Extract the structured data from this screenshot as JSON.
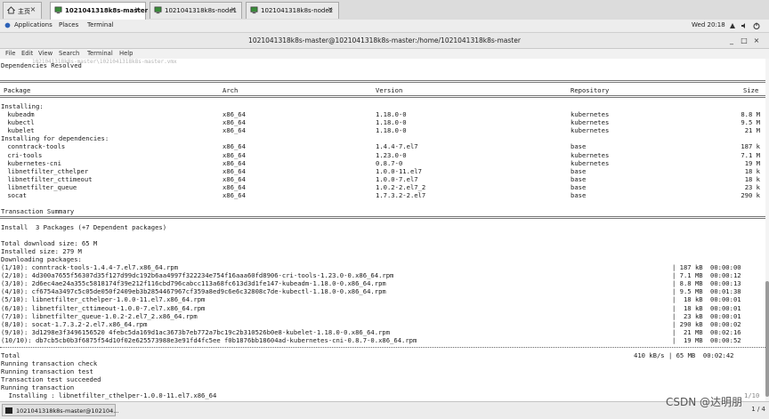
{
  "tabs": [
    {
      "label": "主页",
      "icon": "home-icon"
    },
    {
      "label": "1021041318k8s-master",
      "icon": "vm-icon"
    },
    {
      "label": "1021041318k8s-node1",
      "icon": "vm-icon"
    },
    {
      "label": "1021041318k8s-node2",
      "icon": "vm-icon"
    }
  ],
  "gnome": {
    "applications": "Applications",
    "places": "Places",
    "terminal": "Terminal",
    "clock": "Wed 20:18"
  },
  "window": {
    "title": "1021041318k8s-master@1021041318k8s-master:/home/1021041318k8s-master"
  },
  "menu": {
    "file": "File",
    "edit": "Edit",
    "view": "View",
    "search": "Search",
    "terminal": "Terminal",
    "help": "Help",
    "ghost_path": "1021041318k8s-master\\1021041318k8s-master.vmx"
  },
  "terminal": {
    "deps_resolved": "Dependencies Resolved",
    "headers": {
      "package": "Package",
      "arch": "Arch",
      "version": "Version",
      "repository": "Repository",
      "size": "Size"
    },
    "installing_label": "Installing:",
    "installing": [
      {
        "package": " kubeadm",
        "arch": "x86_64",
        "version": "1.18.0-0",
        "repository": "kubernetes",
        "size": "8.8 M"
      },
      {
        "package": " kubectl",
        "arch": "x86_64",
        "version": "1.18.0-0",
        "repository": "kubernetes",
        "size": "9.5 M"
      },
      {
        "package": " kubelet",
        "arch": "x86_64",
        "version": "1.18.0-0",
        "repository": "kubernetes",
        "size": "21 M"
      }
    ],
    "deps_label": "Installing for dependencies:",
    "deps": [
      {
        "package": " conntrack-tools",
        "arch": "x86_64",
        "version": "1.4.4-7.el7",
        "repository": "base",
        "size": "187 k"
      },
      {
        "package": " cri-tools",
        "arch": "x86_64",
        "version": "1.23.0-0",
        "repository": "kubernetes",
        "size": "7.1 M"
      },
      {
        "package": " kubernetes-cni",
        "arch": "x86_64",
        "version": "0.8.7-0",
        "repository": "kubernetes",
        "size": "19 M"
      },
      {
        "package": " libnetfilter_cthelper",
        "arch": "x86_64",
        "version": "1.0.0-11.el7",
        "repository": "base",
        "size": "18 k"
      },
      {
        "package": " libnetfilter_cttimeout",
        "arch": "x86_64",
        "version": "1.0.0-7.el7",
        "repository": "base",
        "size": "18 k"
      },
      {
        "package": " libnetfilter_queue",
        "arch": "x86_64",
        "version": "1.0.2-2.el7_2",
        "repository": "base",
        "size": "23 k"
      },
      {
        "package": " socat",
        "arch": "x86_64",
        "version": "1.7.3.2-2.el7",
        "repository": "base",
        "size": "290 k"
      }
    ],
    "summary_title": "Transaction Summary",
    "install_line": "Install  3 Packages (+7 Dependent packages)",
    "total_download": "Total download size: 65 M",
    "installed_size": "Installed size: 279 M",
    "downloading": "Downloading packages:",
    "downloads": [
      {
        "name": "(1/10): conntrack-tools-1.4.4-7.el7.x86_64.rpm",
        "size": "| 187 kB",
        "time": "00:00:00"
      },
      {
        "name": "(2/10): 4d300a7655f56307d35f127d99dc192b6aa4997f322234e754f16aaa60fd8906-cri-tools-1.23.0-0.x86_64.rpm",
        "size": "| 7.1 MB",
        "time": "00:00:12"
      },
      {
        "name": "(3/10): 2d6ec4ae24a355c5818174f39e212f116cbd796cabcc113a68fc613d3d1fe147-kubeadm-1.18.0-0.x86_64.rpm",
        "size": "| 8.8 MB",
        "time": "00:00:13"
      },
      {
        "name": "(4/10): cf6754a3497c5c05de050f2409eb3b2854467967cf359a8ed9c6e6c32808c7de-kubectl-1.18.0-0.x86_64.rpm",
        "size": "| 9.5 MB",
        "time": "00:01:38"
      },
      {
        "name": "(5/10): libnetfilter_cthelper-1.0.0-11.el7.x86_64.rpm",
        "size": "|  18 kB",
        "time": "00:00:01"
      },
      {
        "name": "(6/10): libnetfilter_cttimeout-1.0.0-7.el7.x86_64.rpm",
        "size": "|  18 kB",
        "time": "00:00:01"
      },
      {
        "name": "(7/10): libnetfilter_queue-1.0.2-2.el7_2.x86_64.rpm",
        "size": "|  23 kB",
        "time": "00:00:01"
      },
      {
        "name": "(8/10): socat-1.7.3.2-2.el7.x86_64.rpm",
        "size": "| 290 kB",
        "time": "00:00:02"
      },
      {
        "name": "(9/10): 3d1298e3f3496156520 4febc5da169d1ac3673b7eb772a7bc19c2b310526b0e8-kubelet-1.18.0-0.x86_64.rpm",
        "size": "|  21 MB",
        "time": "00:02:16"
      },
      {
        "name": "(10/10): db7cb5cb0b3f6875f54d10f02e625573988e3e91fd4fc5ee f0b1876bb18604ad-kubernetes-cni-0.8.7-0.x86_64.rpm",
        "size": "|  19 MB",
        "time": "00:00:52"
      }
    ],
    "total_label": "Total",
    "total_rate": "410 kB/s | 65 MB  00:02:42",
    "tail": [
      "Running transaction check",
      "Running transaction test",
      "Transaction test succeeded",
      "Running transaction"
    ],
    "installing_progress": "  Installing : libnetfilter_cthelper-1.0.0-11.el7.x86_64",
    "progress_count": "1/10"
  },
  "taskbar": {
    "item": "1021041318k8s-master@102104...",
    "pager": "1 / 4"
  },
  "watermark": "CSDN @达明朋"
}
